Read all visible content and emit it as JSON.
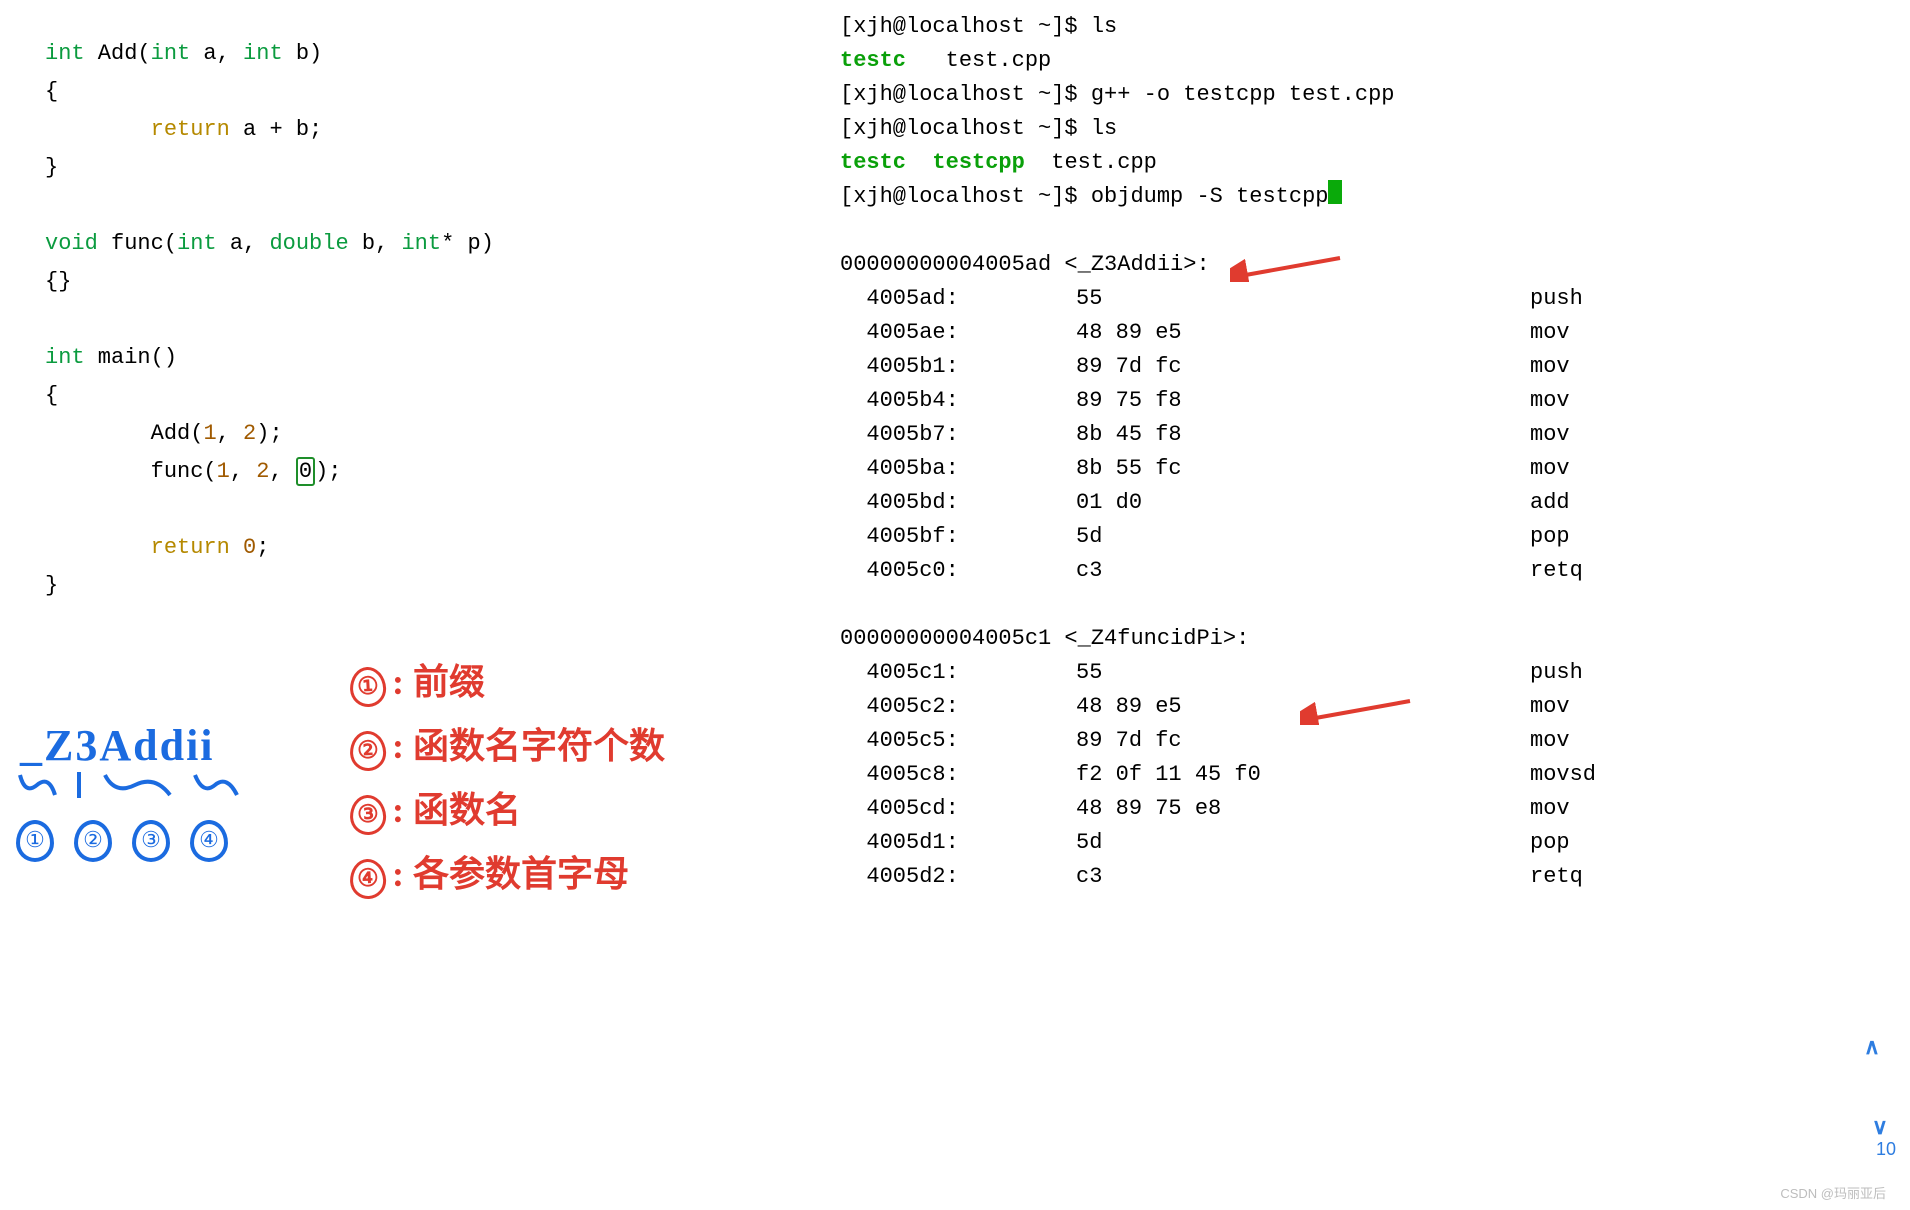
{
  "code": {
    "l1a": "int",
    "l1b": " Add(",
    "l1c": "int",
    "l1d": " a, ",
    "l1e": "int",
    "l1f": " b)",
    "l2": "{",
    "l3a": "        return",
    "l3b": " a + b;",
    "l4": "}",
    "l5a": "void",
    "l5b": " func(",
    "l5c": "int",
    "l5d": " a, ",
    "l5e": "double",
    "l5f": " b, ",
    "l5g": "int",
    "l5h": "* p)",
    "l6": "{}",
    "l7a": "int",
    "l7b": " main()",
    "l8": "{",
    "l9a": "        Add(",
    "l9b": "1",
    "l9c": ", ",
    "l9d": "2",
    "l9e": ");",
    "l10a": "        func(",
    "l10b": "1",
    "l10c": ", ",
    "l10d": "2",
    "l10e": ", ",
    "l10f": "0",
    "l10g": ");",
    "l11a": "        return",
    "l11b": " ",
    "l11c": "0",
    "l11d": ";",
    "l12": "}"
  },
  "hand": {
    "z3": "_Z3Addii",
    "n1": "①",
    "n2": "②",
    "n3": "③",
    "n4": "④",
    "d1n": "①",
    "d1": ": 前缀",
    "d2n": "②",
    "d2": ": 函数名字符个数",
    "d3n": "③",
    "d3": ": 函数名",
    "d4n": "④",
    "d4": ": 各参数首字母"
  },
  "term": {
    "p1": "[xjh@localhost ~]$ ls",
    "p2a": "testc",
    "p2b": "   test.cpp",
    "p3": "[xjh@localhost ~]$ g++ -o testcpp test.cpp",
    "p4": "[xjh@localhost ~]$ ls",
    "p5a": "testc  testcpp",
    "p5b": "  test.cpp",
    "p6": "[xjh@localhost ~]$ objdump -S testcpp"
  },
  "obj": {
    "h1": "00000000004005ad <_Z3Addii>:",
    "h2": "00000000004005c1 <_Z4funcidPi>:",
    "r1": {
      "a": "  4005ad:",
      "b": "     55",
      "m": "push"
    },
    "r2": {
      "a": "  4005ae:",
      "b": "     48 89 e5",
      "m": "mov"
    },
    "r3": {
      "a": "  4005b1:",
      "b": "     89 7d fc",
      "m": "mov"
    },
    "r4": {
      "a": "  4005b4:",
      "b": "     89 75 f8",
      "m": "mov"
    },
    "r5": {
      "a": "  4005b7:",
      "b": "     8b 45 f8",
      "m": "mov"
    },
    "r6": {
      "a": "  4005ba:",
      "b": "     8b 55 fc",
      "m": "mov"
    },
    "r7": {
      "a": "  4005bd:",
      "b": "     01 d0",
      "m": "add"
    },
    "r8": {
      "a": "  4005bf:",
      "b": "     5d",
      "m": "pop"
    },
    "r9": {
      "a": "  4005c0:",
      "b": "     c3",
      "m": "retq"
    },
    "s1": {
      "a": "  4005c1:",
      "b": "     55",
      "m": "push"
    },
    "s2": {
      "a": "  4005c2:",
      "b": "     48 89 e5",
      "m": "mov"
    },
    "s3": {
      "a": "  4005c5:",
      "b": "     89 7d fc",
      "m": "mov"
    },
    "s4": {
      "a": "  4005c8:",
      "b": "     f2 0f 11 45 f0",
      "m": "movsd"
    },
    "s5": {
      "a": "  4005cd:",
      "b": "     48 89 75 e8",
      "m": "mov"
    },
    "s6": {
      "a": "  4005d1:",
      "b": "     5d",
      "m": "pop"
    },
    "s7": {
      "a": "  4005d2:",
      "b": "     c3",
      "m": "retq"
    }
  },
  "footer": {
    "watermark": "CSDN @玛丽亚后",
    "num": "10",
    "up": "∧",
    "down": "∨"
  }
}
